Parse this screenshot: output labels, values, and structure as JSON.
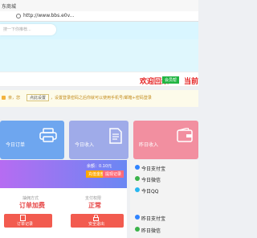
{
  "window": {
    "tab_title": "东商城"
  },
  "addressbar": {
    "url": "http://www.bbs.e0v..."
  },
  "search": {
    "placeholder": "搜一下你推荐..."
  },
  "welcome": {
    "text": "欢迎回来",
    "badge": "会员帮",
    "text2": "当前"
  },
  "notice": {
    "prefix": "亲，您",
    "button": "点此设置",
    "text": "，设置登录密码之后你就可以使用手机号/邮箱+密码登录"
  },
  "stats": [
    {
      "label": "今日订单",
      "color": "#6ea6ef",
      "icon": "printer-icon"
    },
    {
      "label": "今日收入",
      "color": "#9fabe9",
      "icon": "document-icon"
    },
    {
      "label": "昨日收入",
      "color": "#f28fa0",
      "icon": "wallet-icon"
    }
  ],
  "balance": {
    "label": "余额：",
    "value": "0.10元",
    "btn_recharge": "充值金额",
    "btn_withdraw": "提现记录",
    "method_label": "抽佣方式",
    "method_value": "订单加费",
    "status_label": "支付权限",
    "status_value": "正常",
    "btn_orders": "订单记录",
    "btn_logout": "安全退出"
  },
  "side": {
    "items": [
      {
        "label": "今日支付宝",
        "color": "#2f84ff"
      },
      {
        "label": "今日微信",
        "color": "#3bb34a"
      },
      {
        "label": "今日QQ",
        "color": "#28b7f0"
      },
      {
        "label": "昨日支付宝",
        "color": "#2f84ff"
      },
      {
        "label": "昨日微信",
        "color": "#3bb34a"
      }
    ]
  }
}
